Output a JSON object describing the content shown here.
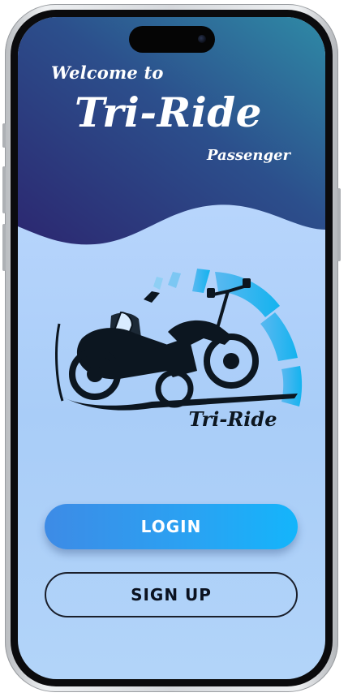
{
  "header": {
    "welcome": "Welcome to",
    "app_name": "Tri-Ride",
    "subtitle": "Passenger"
  },
  "logo": {
    "brand_text": "Tri-Ride",
    "description_icon": "motorcycle-sidecar-icon"
  },
  "buttons": {
    "login_label": "LOGIN",
    "signup_label": "SIGN UP"
  },
  "colors": {
    "header_gradient_start": "#2c2f74",
    "header_gradient_end": "#2f8aa6",
    "screen_background": "#b4d3fb",
    "login_button": "#2aa0f2",
    "logo_accent": "#16b4ef"
  }
}
